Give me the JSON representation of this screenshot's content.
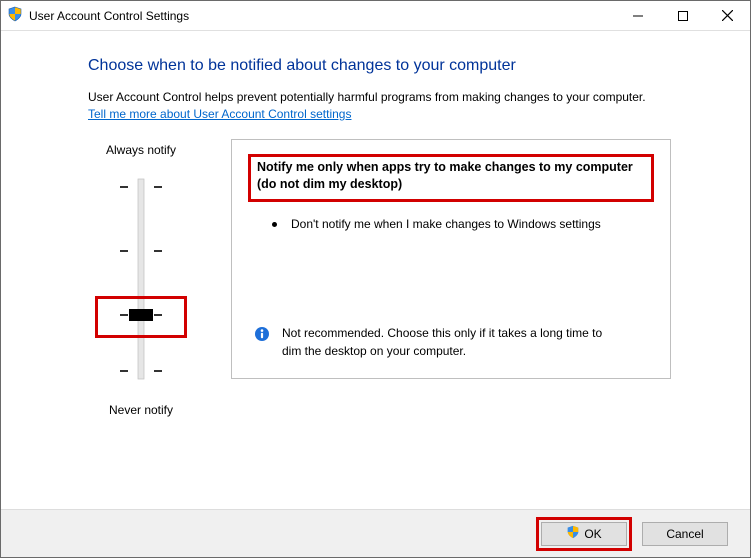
{
  "window": {
    "title": "User Account Control Settings"
  },
  "main": {
    "heading": "Choose when to be notified about changes to your computer",
    "intro": "User Account Control helps prevent potentially harmful programs from making changes to your computer.",
    "link": "Tell me more about User Account Control settings"
  },
  "slider": {
    "top_label": "Always notify",
    "bottom_label": "Never notify",
    "levels": 4,
    "selected_index": 2
  },
  "panel": {
    "title": "Notify me only when apps try to make changes to my computer (do not dim my desktop)",
    "bullet": "Don't notify me when I make changes to Windows settings",
    "recommendation": "Not recommended. Choose this only if it takes a long time to dim the desktop on your computer."
  },
  "footer": {
    "ok": "OK",
    "cancel": "Cancel"
  }
}
